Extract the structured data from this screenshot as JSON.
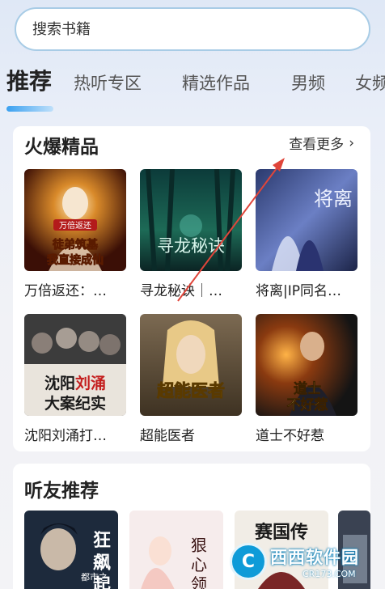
{
  "search": {
    "placeholder": "搜索书籍"
  },
  "tabs": [
    {
      "label": "推荐",
      "active": true
    },
    {
      "label": "热听专区"
    },
    {
      "label": "精选作品"
    },
    {
      "label": "男频"
    },
    {
      "label": "女频"
    }
  ],
  "featured": {
    "title": "火爆精品",
    "see_more": "查看更多",
    "books": [
      {
        "title": "万倍返还：…",
        "cover_text": "徒弟筑基，我直接成仙",
        "cover_tag": "万倍返还",
        "icon": "book-cover-image"
      },
      {
        "title": "寻龙秘诀｜…",
        "cover_text": "寻龙秘诀",
        "icon": "book-cover-image"
      },
      {
        "title": "将离|IP同名…",
        "cover_text": "将离",
        "icon": "book-cover-image"
      },
      {
        "title": "沈阳刘涌打…",
        "cover_text": "沈阳刘涌大案纪实",
        "icon": "book-cover-image"
      },
      {
        "title": "超能医者",
        "cover_text": "超能医者",
        "icon": "book-cover-image"
      },
      {
        "title": "道士不好惹",
        "cover_text": "道士不好惹",
        "icon": "book-cover-image"
      }
    ]
  },
  "friends": {
    "title": "听友推荐",
    "books": [
      {
        "cover_text": "狂飙起",
        "cover_tag": "都市之",
        "icon": "book-cover-image"
      },
      {
        "cover_text": "狠心领",
        "icon": "book-cover-image"
      },
      {
        "cover_text": "赛国传",
        "icon": "book-cover-image"
      }
    ]
  },
  "watermark": {
    "brand": "西西软件园",
    "url": "CR173.COM",
    "logo_text": "C"
  },
  "colors": {
    "accent": "#3aa0f0",
    "search_border": "#a8cce6",
    "annotation": "#e0453a"
  }
}
